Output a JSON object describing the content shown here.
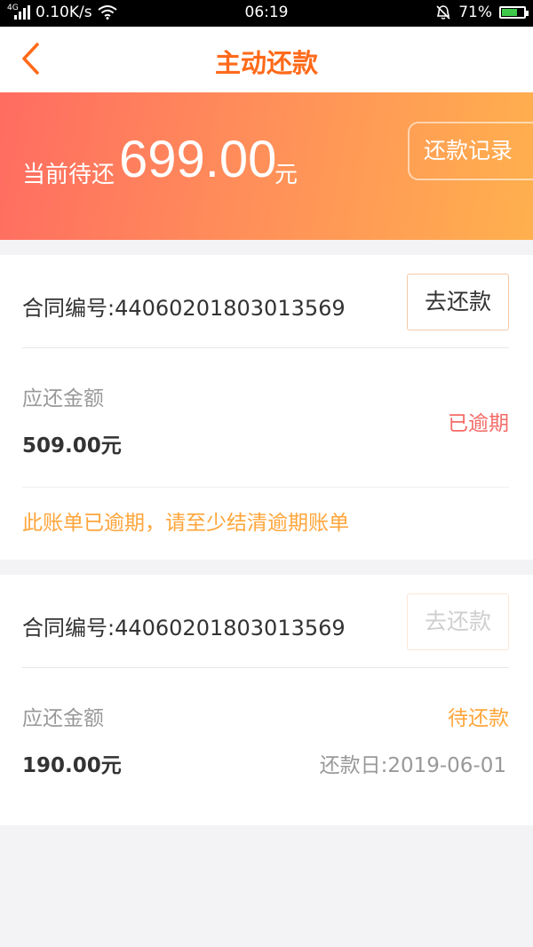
{
  "status_bar": {
    "network": "4G",
    "speed": "0.10K/s",
    "time": "06:19",
    "battery": "71%",
    "battery_level": 0.71
  },
  "nav": {
    "title": "主动还款"
  },
  "summary": {
    "label": "当前待还",
    "amount": "699.00",
    "unit": "元",
    "records_button": "还款记录"
  },
  "bills": [
    {
      "contract": "合同编号:44060201803013569",
      "pay_button": "去还款",
      "due_label": "应还金额",
      "due_amount": "509.00元",
      "status": "已逾期",
      "notice": "此账单已逾期，请至少结清逾期账单"
    },
    {
      "contract": "合同编号:44060201803013569",
      "pay_button": "去还款",
      "due_label": "应还金额",
      "due_amount": "190.00元",
      "status": "待还款",
      "pay_date": "还款日:2019-06-01"
    }
  ],
  "colors": {
    "accent": "#ff6a1a",
    "overdue": "#f46b67",
    "pending": "#ffa53a"
  }
}
